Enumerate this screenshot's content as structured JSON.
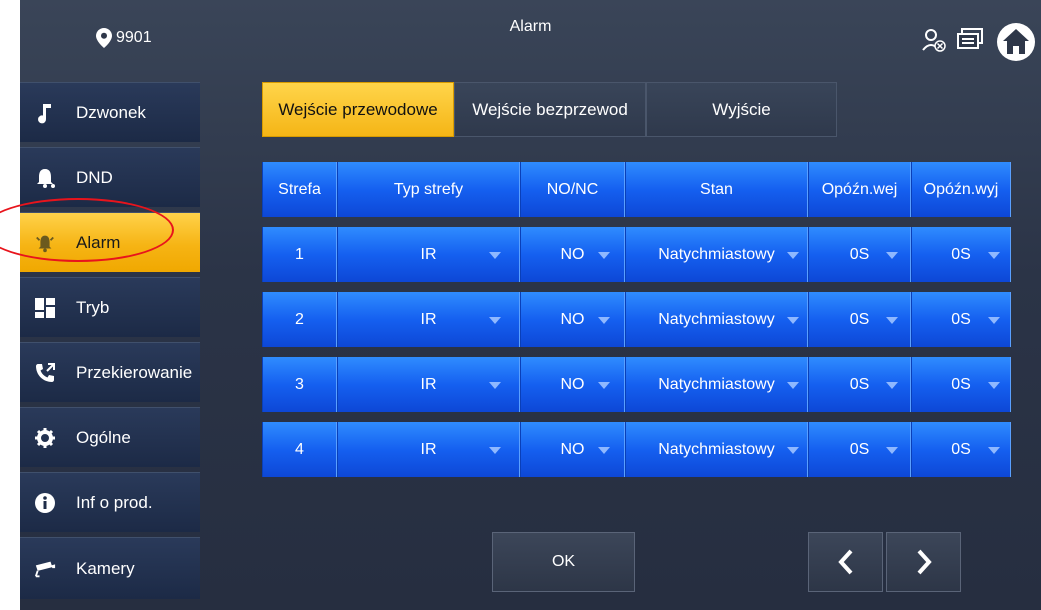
{
  "header": {
    "location": "9901",
    "title": "Alarm",
    "icons": [
      "user-status-icon",
      "monitor-icon",
      "home-icon"
    ]
  },
  "sidebar": {
    "items": [
      {
        "label": "Dzwonek",
        "icon": "music-note-icon"
      },
      {
        "label": "DND",
        "icon": "bell-icon"
      },
      {
        "label": "Alarm",
        "icon": "alarm-bell-icon"
      },
      {
        "label": "Tryb",
        "icon": "grid-icon"
      },
      {
        "label": "Przekierowanie",
        "icon": "phone-forward-icon"
      },
      {
        "label": "Ogólne",
        "icon": "gear-icon"
      },
      {
        "label": "Inf o prod.",
        "icon": "info-icon"
      },
      {
        "label": "Kamery",
        "icon": "camera-icon"
      }
    ],
    "active": "Alarm"
  },
  "tabs": [
    {
      "label": "Wejście przewodowe",
      "active": true
    },
    {
      "label": "Wejście bezprzewod",
      "active": false
    },
    {
      "label": "Wyjście",
      "active": false
    }
  ],
  "table": {
    "headers": [
      "Strefa",
      "Typ strefy",
      "NO/NC",
      "Stan",
      "Opóźn.wej",
      "Opóźn.wyj"
    ],
    "rows": [
      [
        "1",
        "IR",
        "NO",
        "Natychmiastowy",
        "0S",
        "0S"
      ],
      [
        "2",
        "IR",
        "NO",
        "Natychmiastowy",
        "0S",
        "0S"
      ],
      [
        "3",
        "IR",
        "NO",
        "Natychmiastowy",
        "0S",
        "0S"
      ],
      [
        "4",
        "IR",
        "NO",
        "Natychmiastowy",
        "0S",
        "0S"
      ]
    ]
  },
  "buttons": {
    "ok": "OK",
    "prev": "chevron-left-icon",
    "next": "chevron-right-icon"
  },
  "colors": {
    "accent": "#f6b414",
    "table_blue": "#1560f0",
    "highlight": "#e8141c"
  }
}
